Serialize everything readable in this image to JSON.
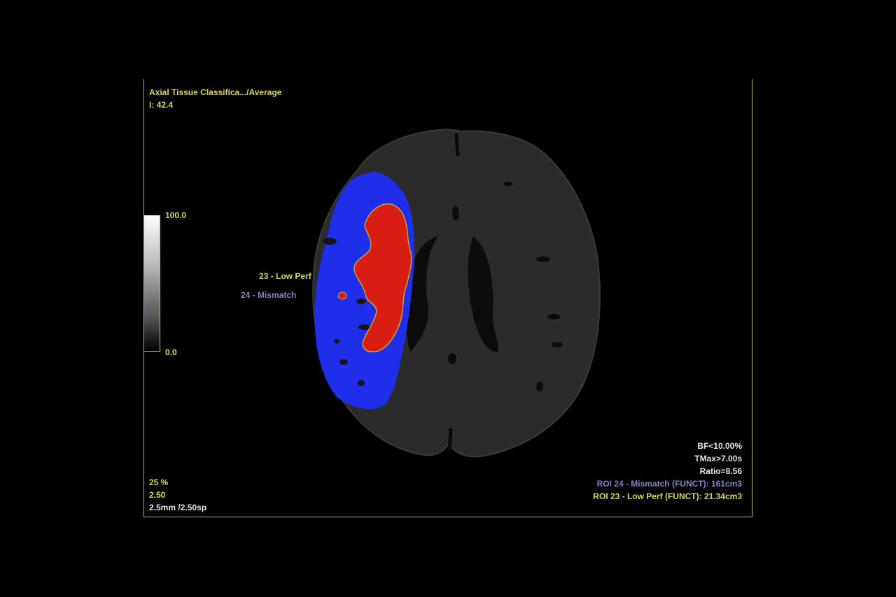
{
  "header": {
    "series_title": "Axial Tissue Classifica.../Average",
    "image_index": "I: 42.4"
  },
  "scale": {
    "max_label": "100.0",
    "min_label": "0.0"
  },
  "roi_labels": {
    "low_perf": "23 - Low Perf",
    "mismatch": "24 - Mismatch"
  },
  "footer_left": {
    "zoom": "25 %",
    "thickness": "2.50",
    "spacing": "2.5mm /2.50sp"
  },
  "footer_right": {
    "bf_threshold": "BF<10.00%",
    "tmax_threshold": "TMax>7.00s",
    "ratio": "Ratio=8.56",
    "roi_mismatch_volume": "ROI 24 - Mismatch (FUNCT): 161cm3",
    "roi_lowperf_volume": "ROI 23 - Low Perf (FUNCT): 21.34cm3"
  },
  "colors": {
    "overlay_text": "#d6d65a",
    "mismatch_text": "#7e86c6",
    "frame": "#b8b85a",
    "mismatch_region": "#1f2ee8",
    "low_perf_region": "#d81e12",
    "brain_tissue": "#2b2b2b"
  }
}
